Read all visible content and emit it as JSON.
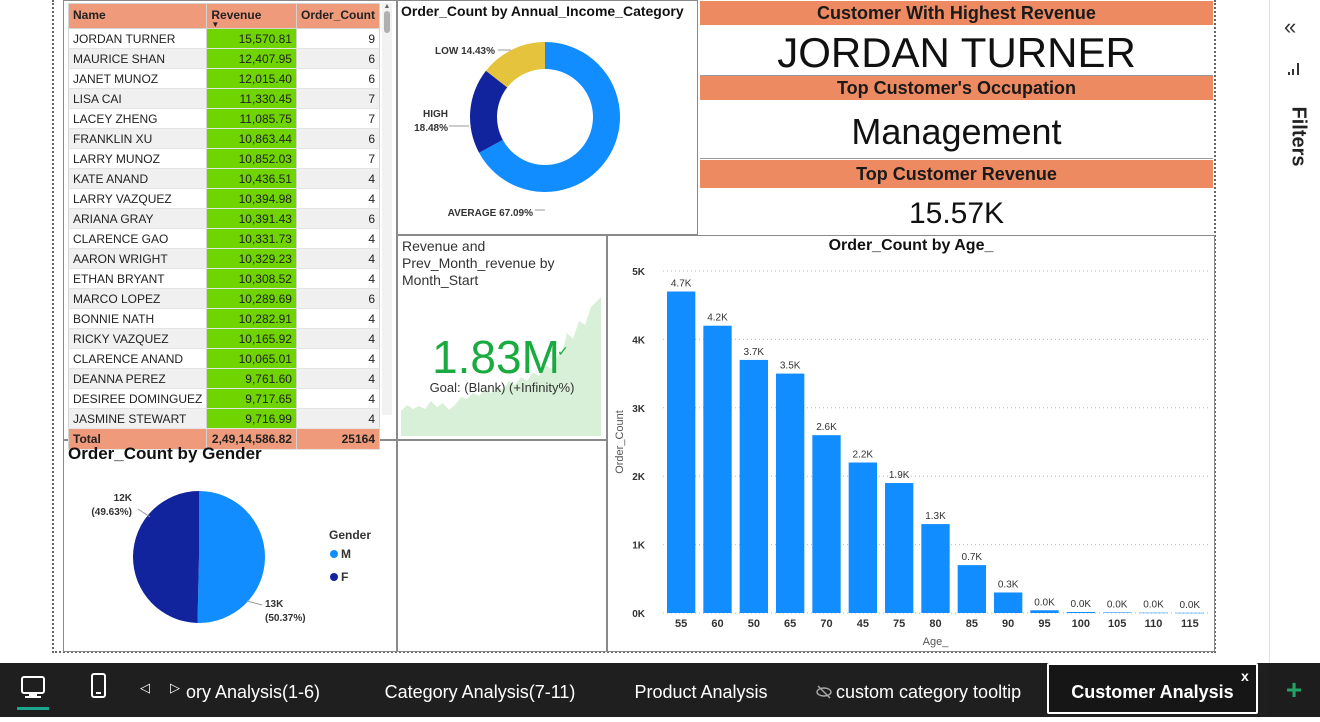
{
  "table": {
    "headers": [
      "Name",
      "Revenue",
      "Order_Count"
    ],
    "rows": [
      [
        "JORDAN TURNER",
        "15,570.81",
        "9"
      ],
      [
        "MAURICE SHAN",
        "12,407.95",
        "6"
      ],
      [
        "JANET MUNOZ",
        "12,015.40",
        "6"
      ],
      [
        "LISA CAI",
        "11,330.45",
        "7"
      ],
      [
        "LACEY ZHENG",
        "11,085.75",
        "7"
      ],
      [
        "FRANKLIN XU",
        "10,863.44",
        "6"
      ],
      [
        "LARRY MUNOZ",
        "10,852.03",
        "7"
      ],
      [
        "KATE ANAND",
        "10,436.51",
        "4"
      ],
      [
        "LARRY VAZQUEZ",
        "10,394.98",
        "4"
      ],
      [
        "ARIANA GRAY",
        "10,391.43",
        "6"
      ],
      [
        "CLARENCE GAO",
        "10,331.73",
        "4"
      ],
      [
        "AARON WRIGHT",
        "10,329.23",
        "4"
      ],
      [
        "ETHAN BRYANT",
        "10,308.52",
        "4"
      ],
      [
        "MARCO LOPEZ",
        "10,289.69",
        "6"
      ],
      [
        "BONNIE NATH",
        "10,282.91",
        "4"
      ],
      [
        "RICKY VAZQUEZ",
        "10,165.92",
        "4"
      ],
      [
        "CLARENCE ANAND",
        "10,065.01",
        "4"
      ],
      [
        "DEANNA PEREZ",
        "9,761.60",
        "4"
      ],
      [
        "DESIREE DOMINGUEZ",
        "9,717.65",
        "4"
      ],
      [
        "JASMINE STEWART",
        "9,716.99",
        "4"
      ]
    ],
    "total": [
      "Total",
      "2,49,14,586.82",
      "25164"
    ]
  },
  "cards": {
    "highest_title": "Customer With Highest Revenue",
    "highest_value": "JORDAN TURNER",
    "occupation_title": "Top Customer's Occupation",
    "occupation_value": "Management",
    "revenue_title": "Top Customer Revenue",
    "revenue_value": "15.57K"
  },
  "kpi": {
    "title": "Revenue and Prev_Month_revenue by Month_Start",
    "value": "1.83M",
    "goal": "Goal: (Blank) (+Infinity%)",
    "trend_color": "#d8efd8"
  },
  "colors": {
    "accent": "#118dff",
    "dark_blue": "#12239e",
    "yellow": "#e6c33d",
    "header_orange": "#ed8a62",
    "revenue_green": "#6fd400",
    "kpi_green": "#1aab40"
  },
  "chart_data": [
    {
      "type": "pie",
      "subtype": "donut",
      "title": "Order_Count by Annual_Income_Category",
      "labels": [
        "AVERAGE",
        "HIGH",
        "LOW"
      ],
      "label_text": [
        "AVERAGE 67.09%",
        "HIGH 18.48%",
        "LOW 14.43%"
      ],
      "values": [
        67.09,
        18.48,
        14.43
      ],
      "colors": [
        "#118dff",
        "#12239e",
        "#e6c33d"
      ]
    },
    {
      "type": "pie",
      "title": "Order_Count by Gender",
      "legend_title": "Gender",
      "labels": [
        "M",
        "F"
      ],
      "values": [
        50.37,
        49.63
      ],
      "value_text": [
        "13K",
        "12K"
      ],
      "percent_text": [
        "(50.37%)",
        "(49.63%)"
      ],
      "colors": [
        "#118dff",
        "#12239e"
      ],
      "legend": "right"
    },
    {
      "type": "bar",
      "title": "Order_Count by Age_",
      "xlabel": "Age_",
      "ylabel": "Order_Count",
      "categories": [
        "55",
        "60",
        "50",
        "65",
        "70",
        "45",
        "75",
        "80",
        "85",
        "90",
        "95",
        "100",
        "105",
        "110",
        "115"
      ],
      "values": [
        4700,
        4200,
        3700,
        3500,
        2600,
        2200,
        1900,
        1300,
        700,
        300,
        40,
        15,
        8,
        5,
        3
      ],
      "data_labels": [
        "4.7K",
        "4.2K",
        "3.7K",
        "3.5K",
        "2.6K",
        "2.2K",
        "1.9K",
        "1.3K",
        "0.7K",
        "0.3K",
        "0.0K",
        "0.0K",
        "0.0K",
        "0.0K",
        "0.0K"
      ],
      "yticks": [
        "0K",
        "1K",
        "2K",
        "3K",
        "4K",
        "5K"
      ],
      "ylim": [
        0,
        5000
      ],
      "grid": true,
      "color": "#118dff"
    }
  ],
  "sidebar": {
    "collapse_label": "«",
    "filters_label": "Filters"
  },
  "tabs": [
    {
      "label": "ory Analysis(1-6)",
      "active": false
    },
    {
      "label": "Category Analysis(7-11)",
      "active": false
    },
    {
      "label": "Product Analysis",
      "active": false
    },
    {
      "label": "custom category tooltip",
      "active": false,
      "hidden_icon": true
    },
    {
      "label": "Customer Analysis",
      "active": true
    }
  ],
  "tabbar": {
    "close_label": "x",
    "add_label": "+"
  }
}
